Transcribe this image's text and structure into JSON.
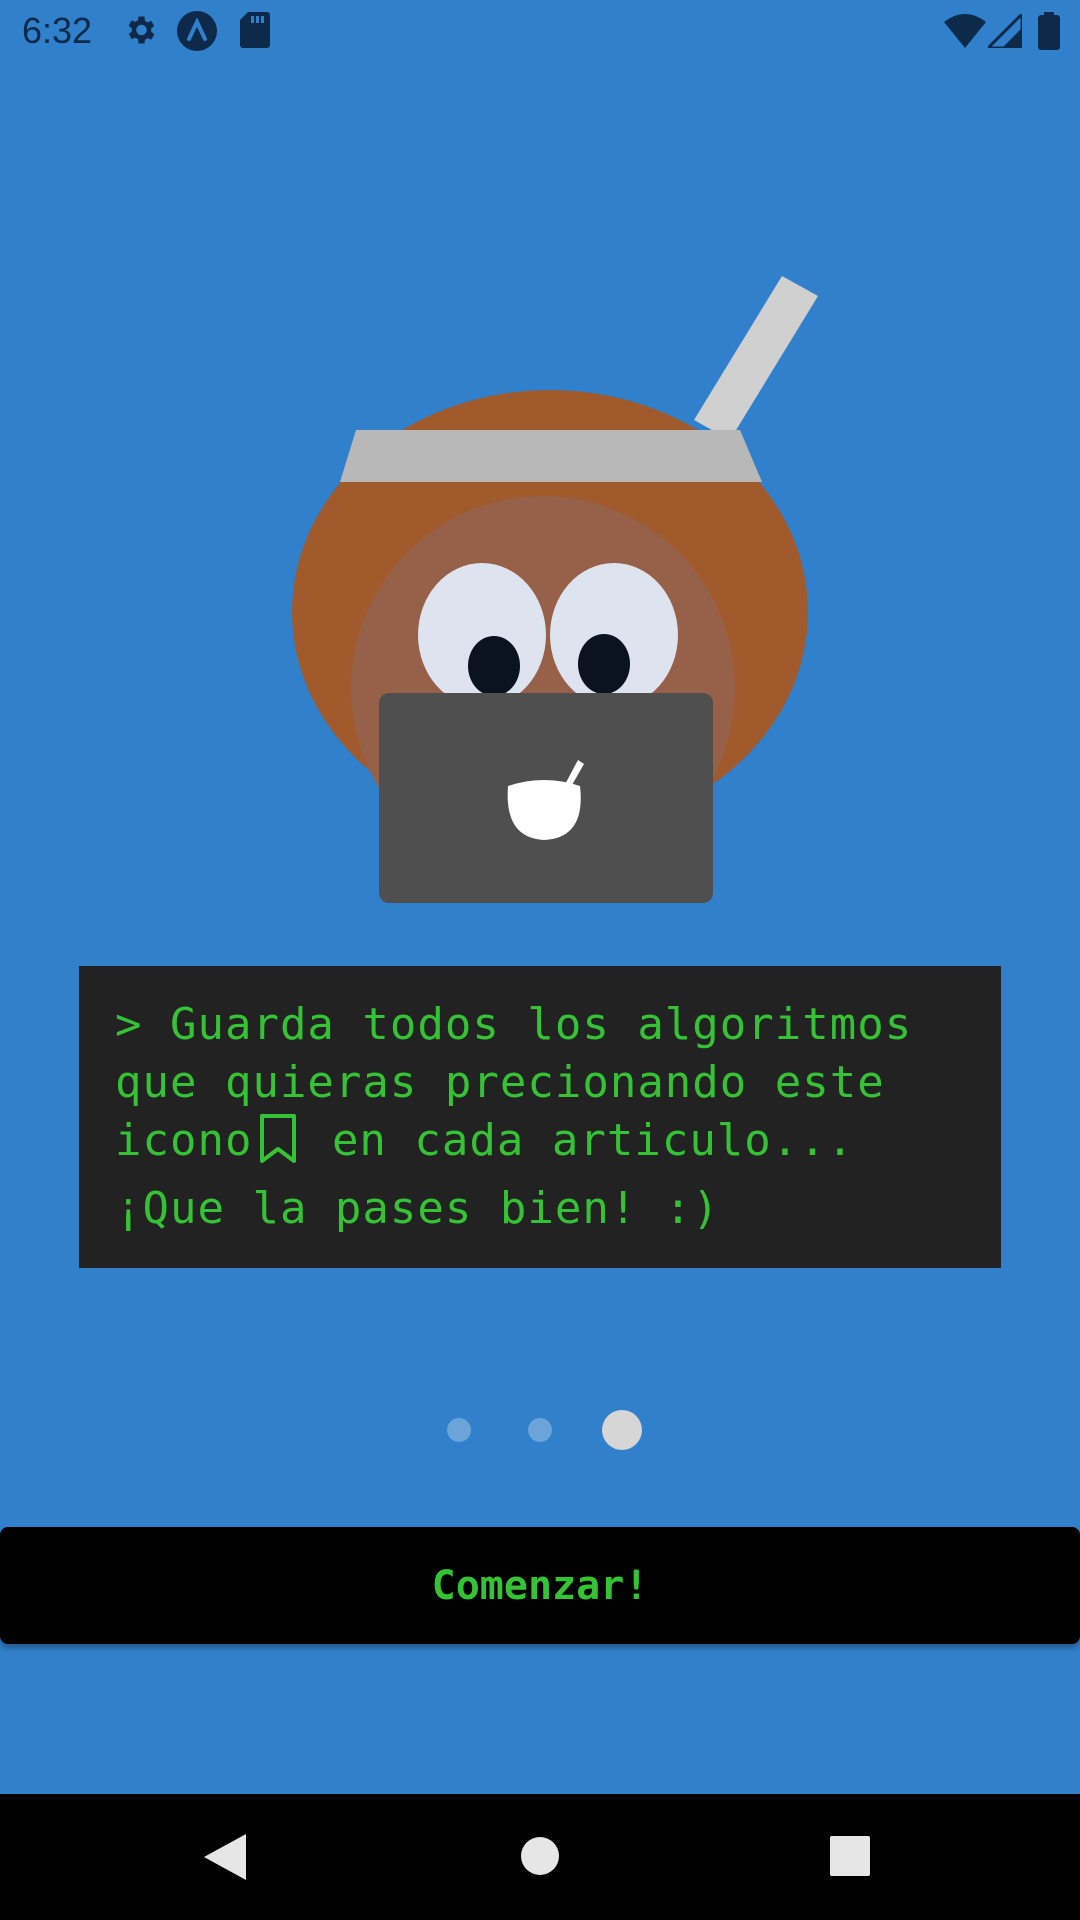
{
  "status_bar": {
    "time": "6:32",
    "icons": [
      "gear-icon",
      "android-auto-icon",
      "sd-card-icon",
      "wifi-icon",
      "cell-signal-icon",
      "battery-icon"
    ]
  },
  "terminal": {
    "line1": "> Guarda todos los algoritmos",
    "line2": "que quieras precionando este",
    "line3_before": "icono",
    "line3_after": "en cada articulo...",
    "line4": "¡Que la pases bien! :)",
    "inline_icon": "bookmark-icon"
  },
  "pager": {
    "count": 3,
    "active_index": 2
  },
  "start_button": {
    "label": "Comenzar!"
  },
  "nav_bar": {
    "back": "back-icon",
    "home": "home-icon",
    "recents": "recents-icon"
  },
  "colors": {
    "background": "#3080cb",
    "terminal_bg": "#222222",
    "terminal_text": "#35c335",
    "button_bg": "#000000",
    "mate_body": "#a05a2c",
    "mate_rim": "#b8b8b8",
    "laptop": "#4f4f4f"
  }
}
